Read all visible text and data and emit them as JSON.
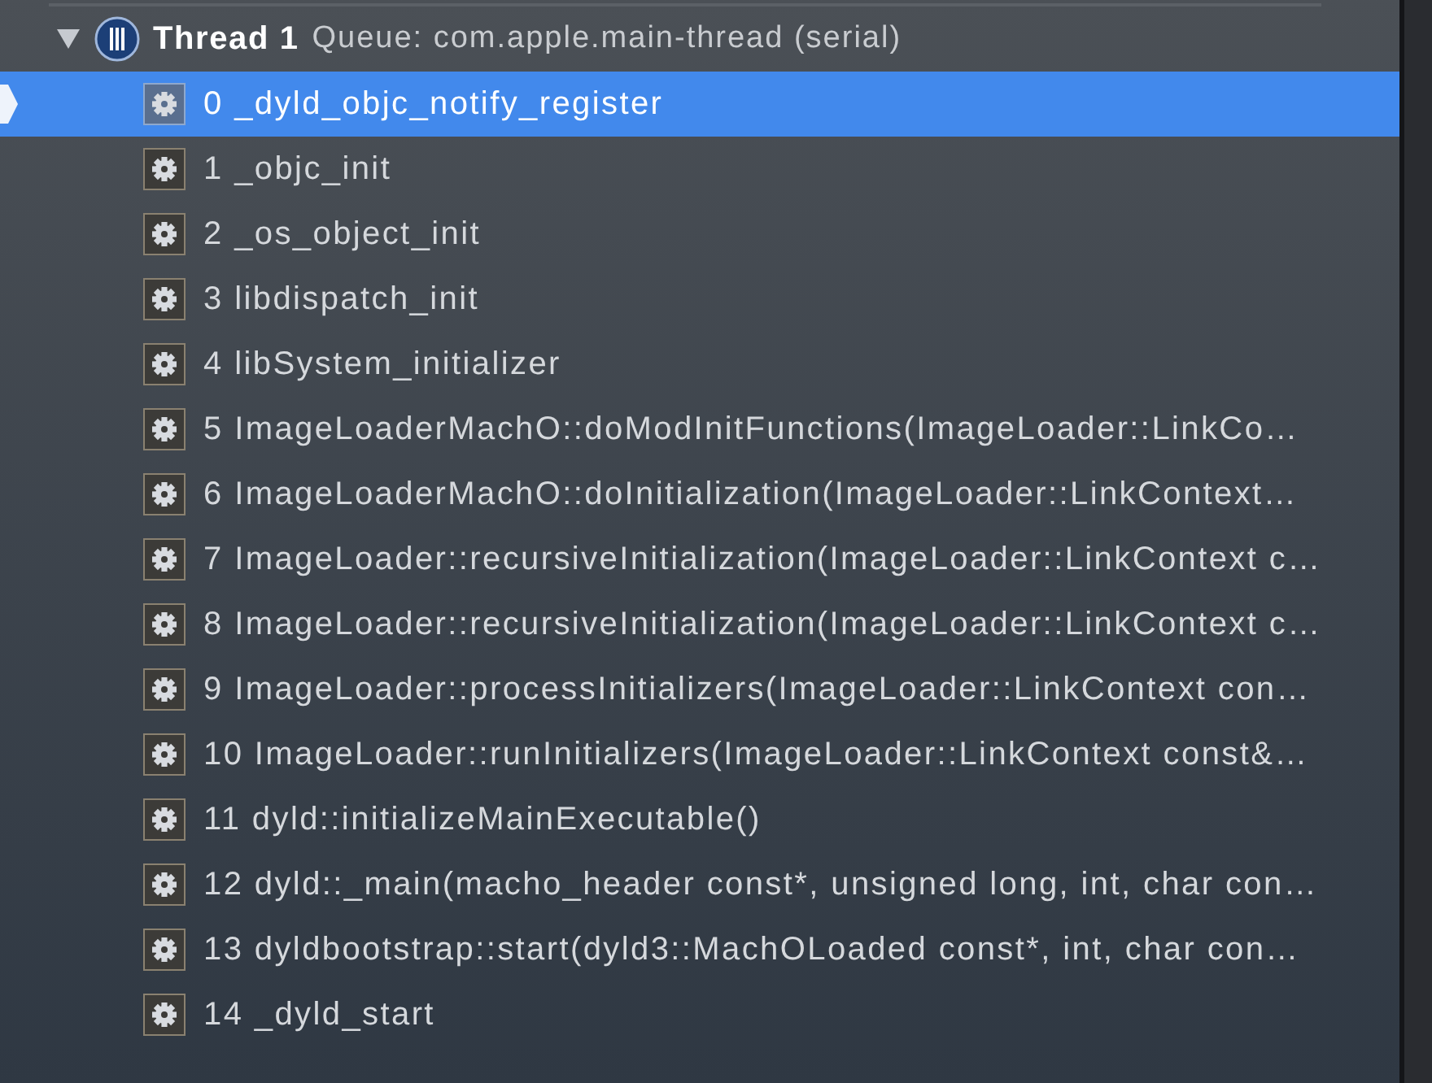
{
  "thread": {
    "expanded": true,
    "name": "Thread 1",
    "queue": "Queue: com.apple.main-thread (serial)"
  },
  "frames": [
    {
      "label": "0 _dyld_objc_notify_register",
      "selected": true
    },
    {
      "label": "1 _objc_init",
      "selected": false
    },
    {
      "label": "2 _os_object_init",
      "selected": false
    },
    {
      "label": "3 libdispatch_init",
      "selected": false
    },
    {
      "label": "4 libSystem_initializer",
      "selected": false
    },
    {
      "label": "5 ImageLoaderMachO::doModInitFunctions(ImageLoader::LinkCo…",
      "selected": false
    },
    {
      "label": "6 ImageLoaderMachO::doInitialization(ImageLoader::LinkContext…",
      "selected": false
    },
    {
      "label": "7 ImageLoader::recursiveInitialization(ImageLoader::LinkContext c…",
      "selected": false
    },
    {
      "label": "8 ImageLoader::recursiveInitialization(ImageLoader::LinkContext c…",
      "selected": false
    },
    {
      "label": "9 ImageLoader::processInitializers(ImageLoader::LinkContext con…",
      "selected": false
    },
    {
      "label": "10 ImageLoader::runInitializers(ImageLoader::LinkContext const&…",
      "selected": false
    },
    {
      "label": "11 dyld::initializeMainExecutable()",
      "selected": false
    },
    {
      "label": "12 dyld::_main(macho_header const*, unsigned long, int, char con…",
      "selected": false
    },
    {
      "label": "13 dyldbootstrap::start(dyld3::MachOLoaded const*, int, char con…",
      "selected": false
    },
    {
      "label": "14 _dyld_start",
      "selected": false
    }
  ]
}
